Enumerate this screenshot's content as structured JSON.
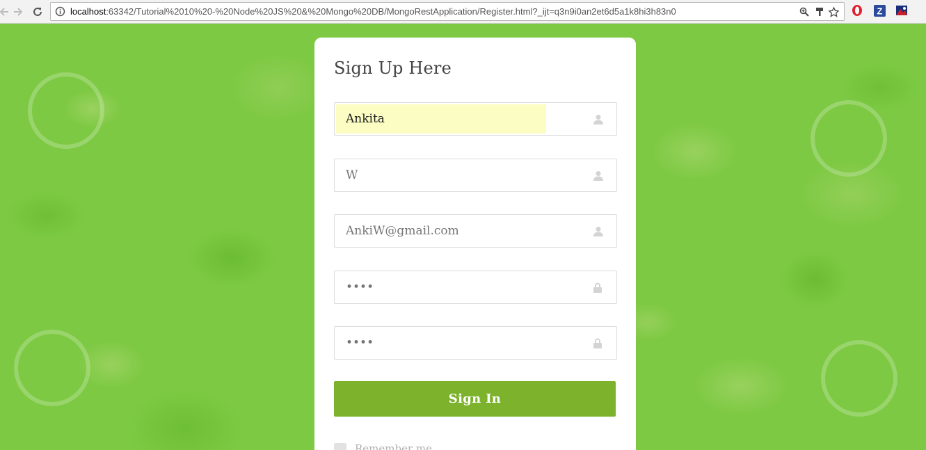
{
  "browser": {
    "url_host": "localhost",
    "url_rest": ":63342/Tutorial%2010%20-%20Node%20JS%20&%20Mongo%20DB/MongoRestApplication/Register.html?_ijt=q3n9i0an2et6d5a1k8hi3h83n0",
    "icons": [
      "back-arrow-icon",
      "forward-arrow-icon",
      "reload-icon",
      "info-icon",
      "zoom-icon",
      "paint-brush-icon",
      "star-icon",
      "opera-icon",
      "z-extension-icon",
      "extension-icon"
    ]
  },
  "form": {
    "title": "Sign Up Here",
    "fields": [
      {
        "name": "first-name",
        "value": "Ankita",
        "placeholder": "",
        "icon": "user-icon"
      },
      {
        "name": "last-name",
        "value": "",
        "placeholder": "W",
        "icon": "user-icon"
      },
      {
        "name": "email",
        "value": "",
        "placeholder": "AnkiW@gmail.com",
        "icon": "user-icon"
      },
      {
        "name": "password",
        "value": "",
        "placeholder": "••••",
        "icon": "lock-icon"
      },
      {
        "name": "confirm-password",
        "value": "",
        "placeholder": "••••",
        "icon": "lock-icon"
      }
    ],
    "submit_label": "Sign In",
    "remember_label": "Remember me"
  },
  "colors": {
    "accent": "#7db22d",
    "background": "#7dc943",
    "autofill": "#fbfdc2"
  }
}
